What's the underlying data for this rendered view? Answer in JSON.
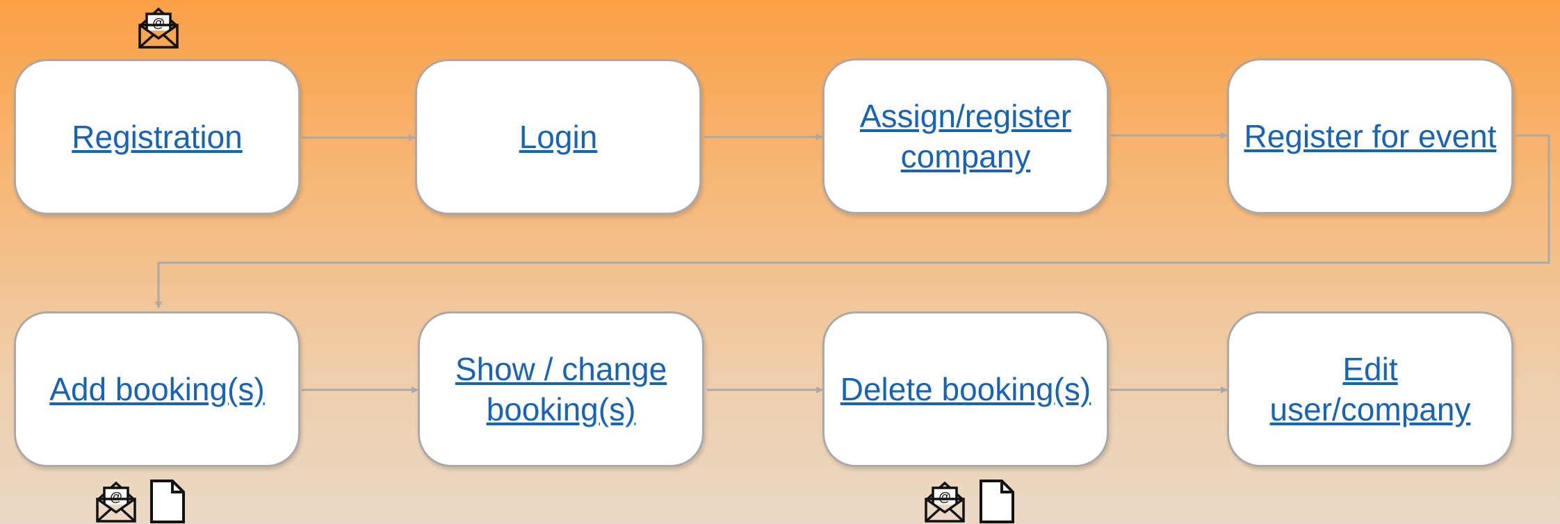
{
  "steps": [
    {
      "id": "registration",
      "label": "Registration"
    },
    {
      "id": "login",
      "label": "Login"
    },
    {
      "id": "assign",
      "label": "Assign/register company"
    },
    {
      "id": "register-event",
      "label": "Register for event"
    },
    {
      "id": "add-booking",
      "label": "Add booking(s)"
    },
    {
      "id": "show-change",
      "label": "Show / change booking(s)"
    },
    {
      "id": "delete",
      "label": "Delete booking(s)"
    },
    {
      "id": "edit",
      "label": "Edit user/company"
    }
  ],
  "icons": {
    "email": "email-icon",
    "document": "document-icon"
  },
  "colors": {
    "link": "#1763b8",
    "connector": "#a9a9a9",
    "gradient_top": "#fba046",
    "gradient_bottom": "#ead9c6"
  }
}
